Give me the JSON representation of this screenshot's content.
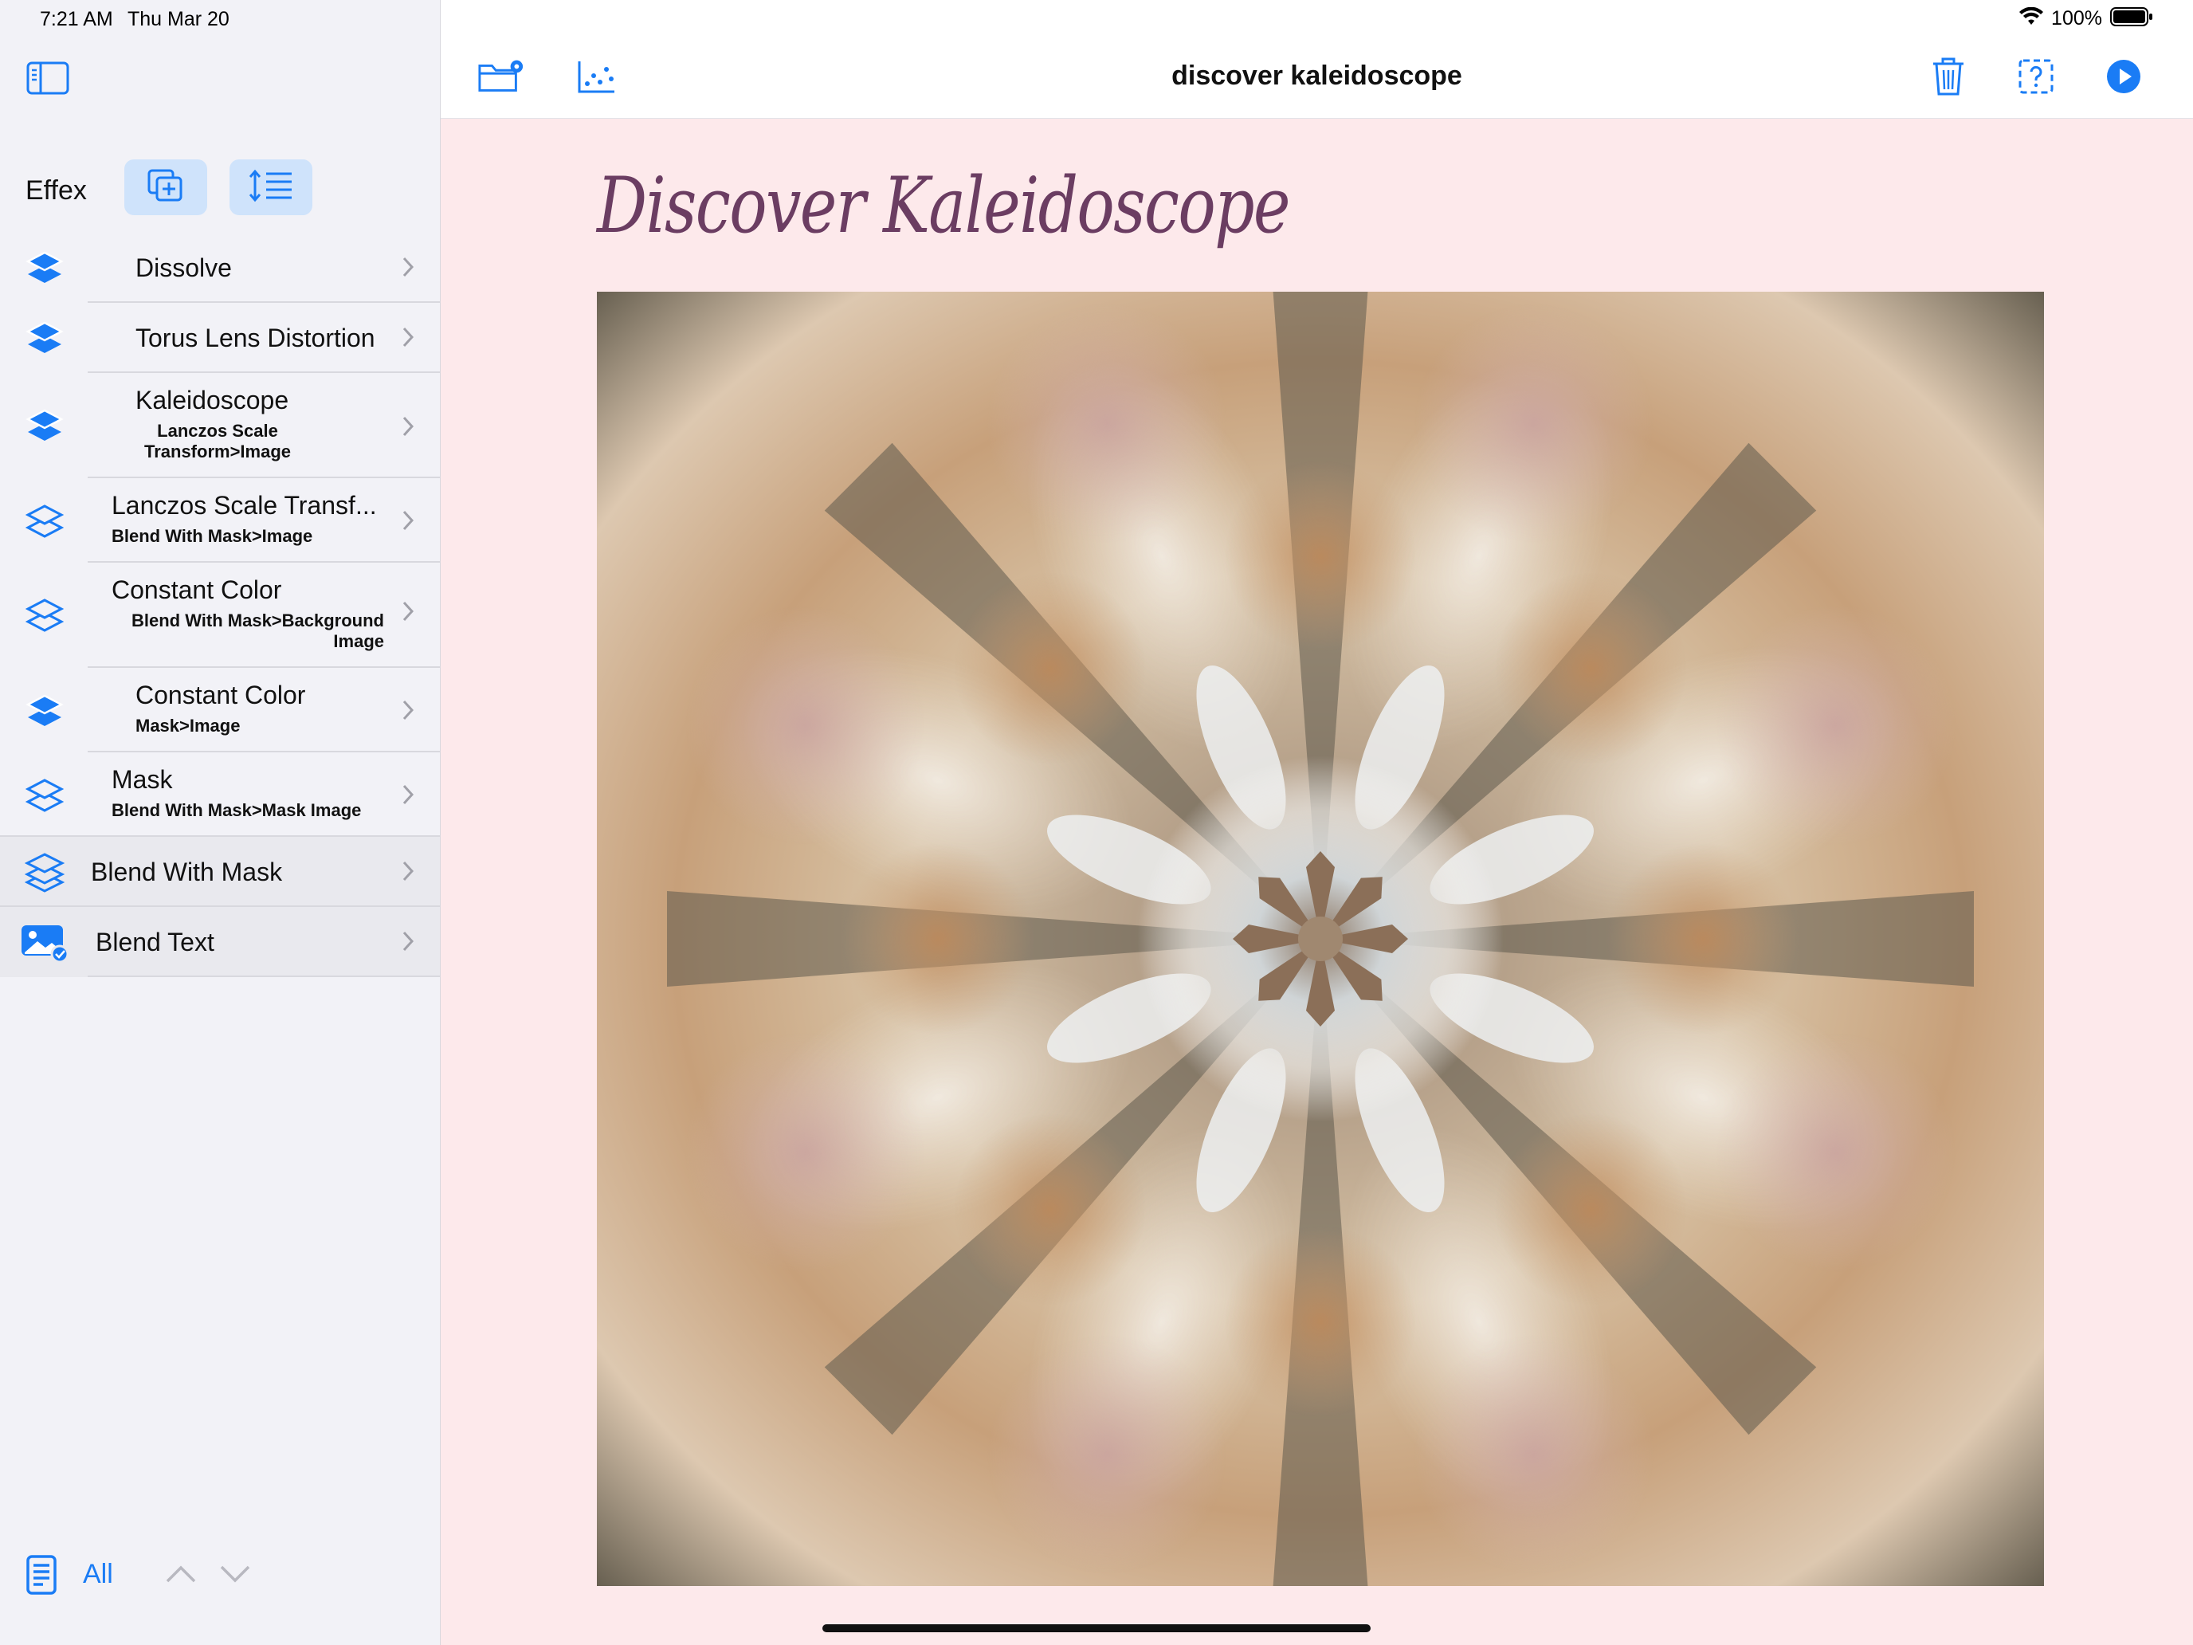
{
  "status_bar": {
    "time": "7:21 AM",
    "date": "Thu Mar 20",
    "battery_pct": "100%",
    "battery_level": 1.0,
    "wifi": "wifi-icon"
  },
  "sidebar": {
    "toggle_icon": "sidebar-toggle-icon",
    "title": "Effex",
    "add_icon": "add-layer-icon",
    "reorder_icon": "reorder-list-icon",
    "items": [
      {
        "title": "Dissolve",
        "subtitle": "",
        "icon": "layers-filled-icon"
      },
      {
        "title": "Torus Lens Distortion",
        "subtitle": "",
        "icon": "layers-filled-icon"
      },
      {
        "title": "Kaleidoscope",
        "subtitle": "Lanczos Scale\nTransform>Image",
        "icon": "layers-filled-icon"
      },
      {
        "title": "Lanczos Scale Transf...",
        "subtitle": "Blend With Mask>Image",
        "icon": "layers-outline-icon"
      },
      {
        "title": "Constant Color",
        "subtitle": "Blend With Mask>Background\nImage",
        "icon": "layers-outline-icon"
      },
      {
        "title": "Constant Color",
        "subtitle": "Mask>Image",
        "icon": "layers-filled-icon"
      },
      {
        "title": "Mask",
        "subtitle": "Blend With Mask>Mask Image",
        "icon": "layers-outline-icon"
      },
      {
        "title": "Blend With Mask",
        "subtitle": "",
        "icon": "layers-stack-icon"
      },
      {
        "title": "Blend Text",
        "subtitle": "",
        "icon": "photo-badge-icon"
      }
    ],
    "footer": {
      "doc_icon": "document-list-icon",
      "filter_label": "All",
      "up_icon": "chevron-up-icon",
      "down_icon": "chevron-down-icon"
    }
  },
  "navbar": {
    "title": "discover kaleidoscope",
    "left_icons": [
      "folder-settings-icon",
      "scatter-chart-icon"
    ],
    "right_icons": [
      "trash-icon",
      "help-icon",
      "play-icon"
    ]
  },
  "canvas": {
    "heading": "Discover Kaleidoscope",
    "image": "kaleidoscope-image",
    "background": "#fde9eb"
  },
  "colors": {
    "accent": "#1a7cf5",
    "heading": "#6b3d62"
  }
}
